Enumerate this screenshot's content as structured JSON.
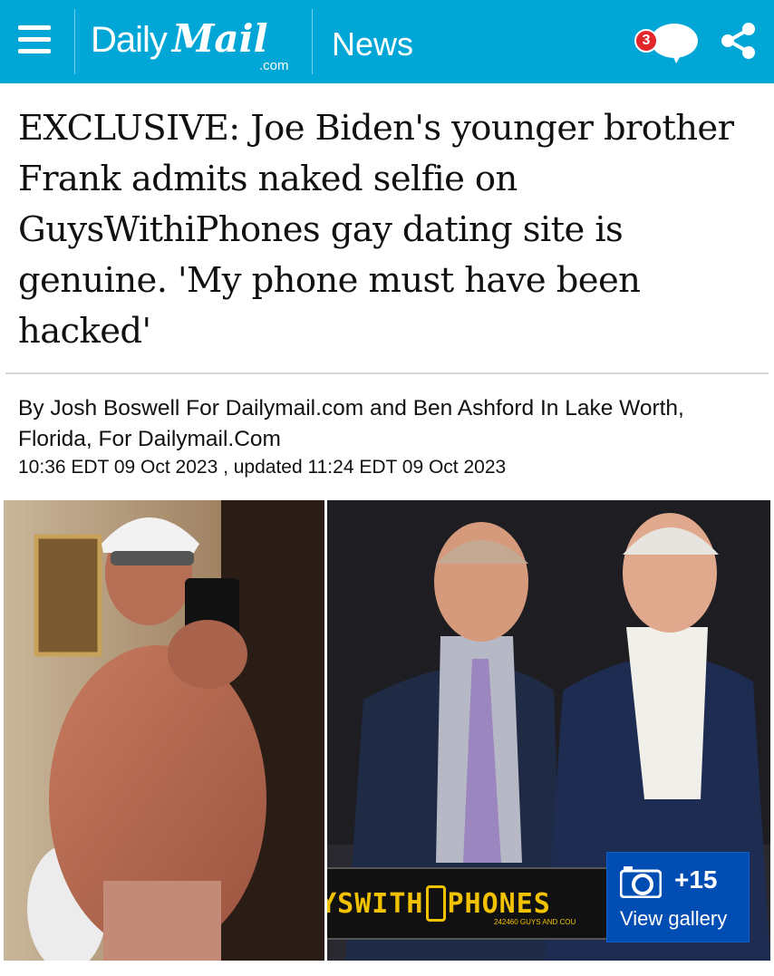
{
  "header": {
    "logo_daily": "Daily",
    "logo_mail": "Mail",
    "logo_com": ".com",
    "section": "News",
    "comment_count": "3",
    "bar_color": "#00a6d6"
  },
  "article": {
    "headline": "EXCLUSIVE: Joe Biden's younger brother Frank admits naked selfie on GuysWithiPhones gay dating site is genuine. 'My phone must have been hacked'",
    "byline": "By Josh Boswell For Dailymail.com and Ben Ashford In Lake Worth, Florida, For Dailymail.Com",
    "dates": "10:36 EDT 09 Oct 2023 , updated 11:24 EDT 09 Oct 2023"
  },
  "media": {
    "overlay_brand_a": "GUYSWITH",
    "overlay_brand_b": "PHONES",
    "overlay_small": "242460 GUYS AND COU",
    "gallery_count": "+15",
    "gallery_label": "View gallery",
    "gallery_color": "#004db3"
  },
  "icons": [
    "menu-icon",
    "comment-bubble-icon",
    "share-icon",
    "camera-icon"
  ]
}
